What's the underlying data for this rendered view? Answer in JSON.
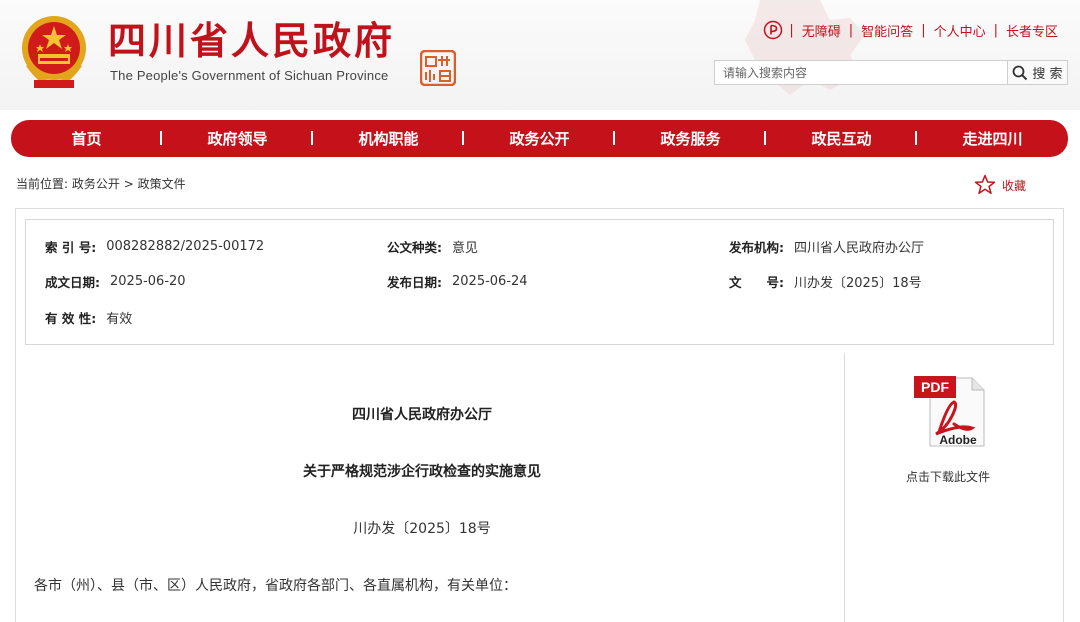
{
  "header": {
    "site_name_cn": "四川省人民政府",
    "site_name_en": "The People's Government of Sichuan Province",
    "quick_links": [
      "无障碍",
      "智能问答",
      "个人中心",
      "长者专区"
    ],
    "search_placeholder": "请输入搜索内容",
    "search_button": "搜 索"
  },
  "nav": {
    "items": [
      "首页",
      "政府领导",
      "机构职能",
      "政务公开",
      "政务服务",
      "政民互动",
      "走进四川"
    ]
  },
  "breadcrumb": {
    "prefix": "当前位置:",
    "items": [
      "政务公开",
      "政策文件"
    ],
    "separator": ">"
  },
  "favorite_label": "收藏",
  "meta": {
    "index_label": "索 引 号:",
    "index_value": "008282882/2025-00172",
    "doc_type_label": "公文种类:",
    "doc_type_value": "意见",
    "issuer_label": "发布机构:",
    "issuer_value": "四川省人民政府办公厅",
    "created_label": "成文日期:",
    "created_value": "2025-06-20",
    "published_label": "发布日期:",
    "published_value": "2025-06-24",
    "doc_no_label": "文　　号:",
    "doc_no_value": "川办发〔2025〕18号",
    "validity_label": "有 效 性:",
    "validity_value": "有效"
  },
  "document": {
    "org": "四川省人民政府办公厅",
    "title": "关于严格规范涉企行政检查的实施意见",
    "number": "川办发〔2025〕18号",
    "salutation": "各市（州）、县（市、区）人民政府，省政府各部门、各直属机构，有关单位："
  },
  "download": {
    "icon_label_top": "PDF",
    "icon_label_bottom": "Adobe",
    "caption": "点击下载此文件"
  },
  "colors": {
    "brand_red": "#c5111a",
    "text": "#333333",
    "border": "#dcdcdc"
  }
}
